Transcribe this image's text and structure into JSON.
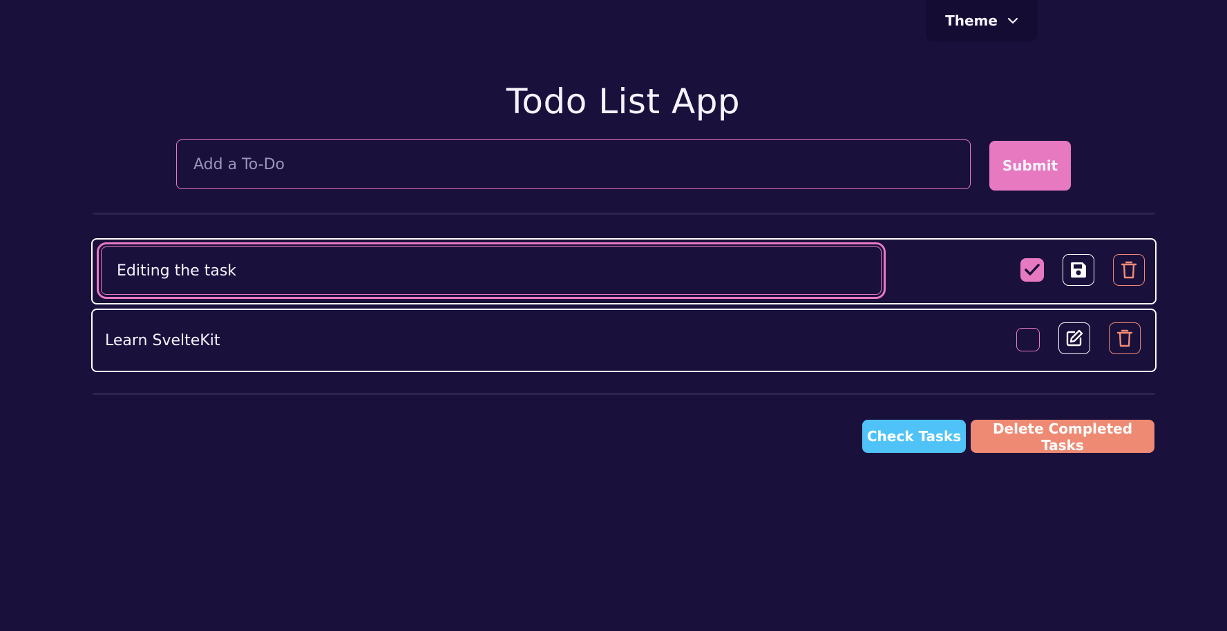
{
  "header": {
    "theme_label": "Theme",
    "theme_icon": "chevron-down-icon"
  },
  "title": "Todo List App",
  "add_form": {
    "placeholder": "Add a To-Do",
    "value": "",
    "submit_label": "Submit"
  },
  "todos": [
    {
      "text": "Editing the task",
      "editing": true,
      "completed": true,
      "action_icon": "save-icon",
      "delete_icon": "trash-icon"
    },
    {
      "text": "Learn SvelteKit",
      "editing": false,
      "completed": false,
      "action_icon": "edit-icon",
      "delete_icon": "trash-icon"
    }
  ],
  "footer": {
    "check_tasks_label": "Check Tasks",
    "delete_completed_label": "Delete Completed Tasks"
  },
  "colors": {
    "background": "#1a103c",
    "accent_pink": "#e779c1",
    "info_blue": "#4fc3f7",
    "danger_salmon": "#ee8a73",
    "text": "#f5f3ff"
  }
}
